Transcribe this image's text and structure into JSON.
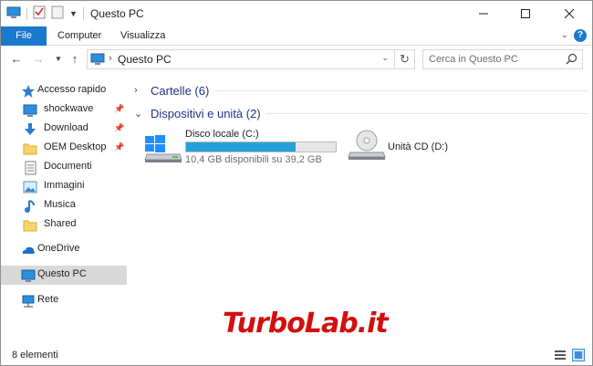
{
  "window": {
    "title": "Questo PC"
  },
  "ribbon": {
    "tabs": [
      "File",
      "Computer",
      "Visualizza"
    ]
  },
  "address": {
    "crumb": "Questo PC"
  },
  "search": {
    "placeholder": "Cerca in Questo PC"
  },
  "sidebar": {
    "items": [
      {
        "label": "Accesso rapido",
        "icon": "star-icon"
      },
      {
        "label": "shockwave",
        "icon": "desktop-icon",
        "pinned": true
      },
      {
        "label": "Download",
        "icon": "download-icon",
        "pinned": true
      },
      {
        "label": "OEM Desktop",
        "icon": "folder-icon",
        "pinned": true
      },
      {
        "label": "Documenti",
        "icon": "documents-icon"
      },
      {
        "label": "Immagini",
        "icon": "pictures-icon"
      },
      {
        "label": "Musica",
        "icon": "music-icon"
      },
      {
        "label": "Shared",
        "icon": "folder-icon"
      },
      {
        "label": "OneDrive",
        "icon": "onedrive-icon"
      },
      {
        "label": "Questo PC",
        "icon": "computer-icon",
        "selected": true
      },
      {
        "label": "Rete",
        "icon": "network-icon"
      }
    ]
  },
  "groups": [
    {
      "label": "Cartelle (6)",
      "expanded": false
    },
    {
      "label": "Dispositivi e unità (2)",
      "expanded": true
    }
  ],
  "drives": [
    {
      "name": "Disco locale (C:)",
      "free": "10,4 GB disponibili su 39,2 GB",
      "used_fraction": 0.73,
      "icon": "windows-drive-icon"
    },
    {
      "name": "Unità CD (D:)",
      "icon": "cd-drive-icon"
    }
  ],
  "status": {
    "count": "8 elementi"
  },
  "watermark": {
    "text": "TurboLab.it"
  },
  "colors": {
    "accent": "#1979ca",
    "bar_fill": "#26a0da",
    "group_heading": "#1e3287",
    "selected_bg": "#d9d9d9"
  }
}
